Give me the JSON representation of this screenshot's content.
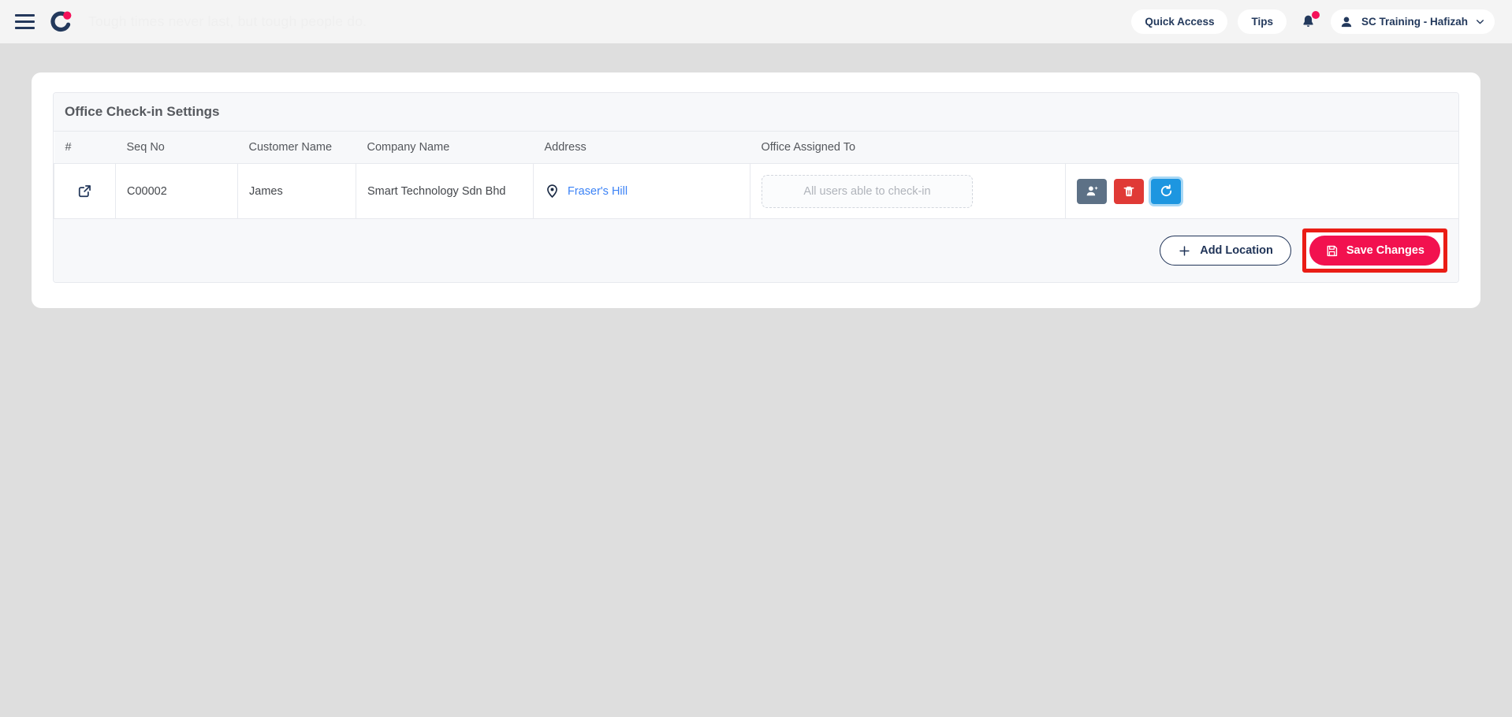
{
  "topbar": {
    "menu_icon": "hamburger-menu-icon",
    "logo_icon": "brand-logo-icon",
    "quote": "Tough times never last, but tough people do.",
    "quick_access_label": "Quick Access",
    "tips_label": "Tips",
    "notification_icon": "bell-icon",
    "user_name": "SC Training - Hafizah",
    "avatar_icon": "user-avatar-icon",
    "chevron_icon": "chevron-down-icon"
  },
  "panel": {
    "title": "Office Check-in Settings",
    "columns": [
      "#",
      "Seq No",
      "Customer Name",
      "Company Name",
      "Address",
      "Office Assigned To",
      ""
    ],
    "rows": [
      {
        "open_icon": "external-link-icon",
        "seq_no": "C00002",
        "customer_name": "James",
        "company_name": "Smart Technology Sdn Bhd",
        "address_icon": "map-pin-icon",
        "address": "Fraser's Hill",
        "assigned_placeholder": "All users able to check-in",
        "actions": [
          {
            "name": "assign-users-button",
            "icon": "user-add-icon",
            "color": "#5d7186"
          },
          {
            "name": "delete-location-button",
            "icon": "trash-icon",
            "color": "#e03a36"
          },
          {
            "name": "refresh-location-button",
            "icon": "refresh-icon",
            "color": "#1d96e0"
          }
        ]
      }
    ],
    "footer": {
      "add_location_label": "Add Location",
      "add_location_icon": "plus-icon",
      "save_label": "Save Changes",
      "save_icon": "save-floppy-icon"
    }
  },
  "colors": {
    "brand_navy": "#23395c",
    "brand_pink": "#f5115a",
    "save_button": "#f2114f",
    "highlight_border": "#ea1d15",
    "link_blue": "#3b82f6",
    "page_bg": "#dedede"
  }
}
